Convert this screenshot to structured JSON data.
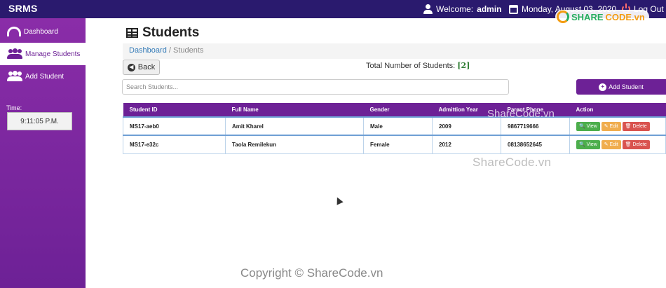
{
  "topbar": {
    "brand": "SRMS",
    "welcome_prefix": "Welcome:",
    "username": "admin",
    "date": "Monday, August 03, 2020",
    "logout": "Log Out"
  },
  "sidebar": {
    "items": [
      {
        "label": "Dashboard",
        "icon": "dashboard-icon"
      },
      {
        "label": "Manage Students",
        "icon": "users-icon"
      },
      {
        "label": "Add Student",
        "icon": "users-icon"
      }
    ],
    "time_label": "Time:",
    "time_value": "9:11:05 P.M."
  },
  "main": {
    "title": "Students",
    "breadcrumb": {
      "link": "Dashboard",
      "separator": "/",
      "current": "Students"
    },
    "back_label": "Back",
    "total_label": "Total Number of Students:",
    "total_count": "[2]",
    "search_placeholder": "Search Students...",
    "add_label": "Add Student"
  },
  "table": {
    "headers": [
      "Student ID",
      "Full Name",
      "Gender",
      "Admittion Year",
      "Parent Phone",
      "Action"
    ],
    "rows": [
      {
        "id": "MS17-aeb0",
        "name": "Amit Kharel",
        "gender": "Male",
        "year": "2009",
        "phone": "9867719666"
      },
      {
        "id": "MS17-e32c",
        "name": "Taola Remilekun",
        "gender": "Female",
        "year": "2012",
        "phone": "08138652645"
      }
    ],
    "actions": {
      "view": "View",
      "edit": "Edit",
      "delete": "Delete"
    }
  },
  "overlays": {
    "watermark_table": "ShareCode.vn",
    "watermark_center": "ShareCode.vn",
    "copyright": "Copyright © ShareCode.vn",
    "logo_a": "SHARE",
    "logo_b": "CODE.vn"
  },
  "colors": {
    "accent": "#6d2196",
    "topbar": "#2a1a6e",
    "view": "#4cae4c",
    "edit": "#f0ad4e",
    "delete": "#d9534f"
  }
}
